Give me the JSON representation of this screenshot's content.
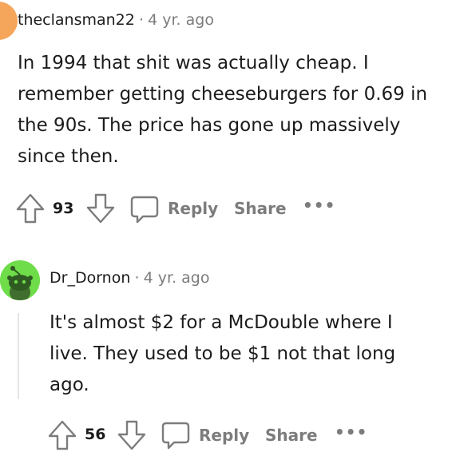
{
  "comments": [
    {
      "username": "theclansman22",
      "separator": "·",
      "time": "4 yr. ago",
      "body": "In 1994 that shit was actually cheap. I remember getting cheeseburgers for 0.69 in the 90s. The price has gone up massively since then.",
      "votes": "93",
      "reply_label": "Reply",
      "share_label": "Share",
      "more_label": "•••",
      "avatar_color": "#f5a65a"
    },
    {
      "username": "Dr_Dornon",
      "separator": "·",
      "time": "4 yr. ago",
      "body": "It's almost $2 for a McDouble where I live. They used to be $1 not that long ago.",
      "votes": "56",
      "reply_label": "Reply",
      "share_label": "Share",
      "more_label": "•••",
      "avatar_color": "#6fdc4a"
    }
  ]
}
